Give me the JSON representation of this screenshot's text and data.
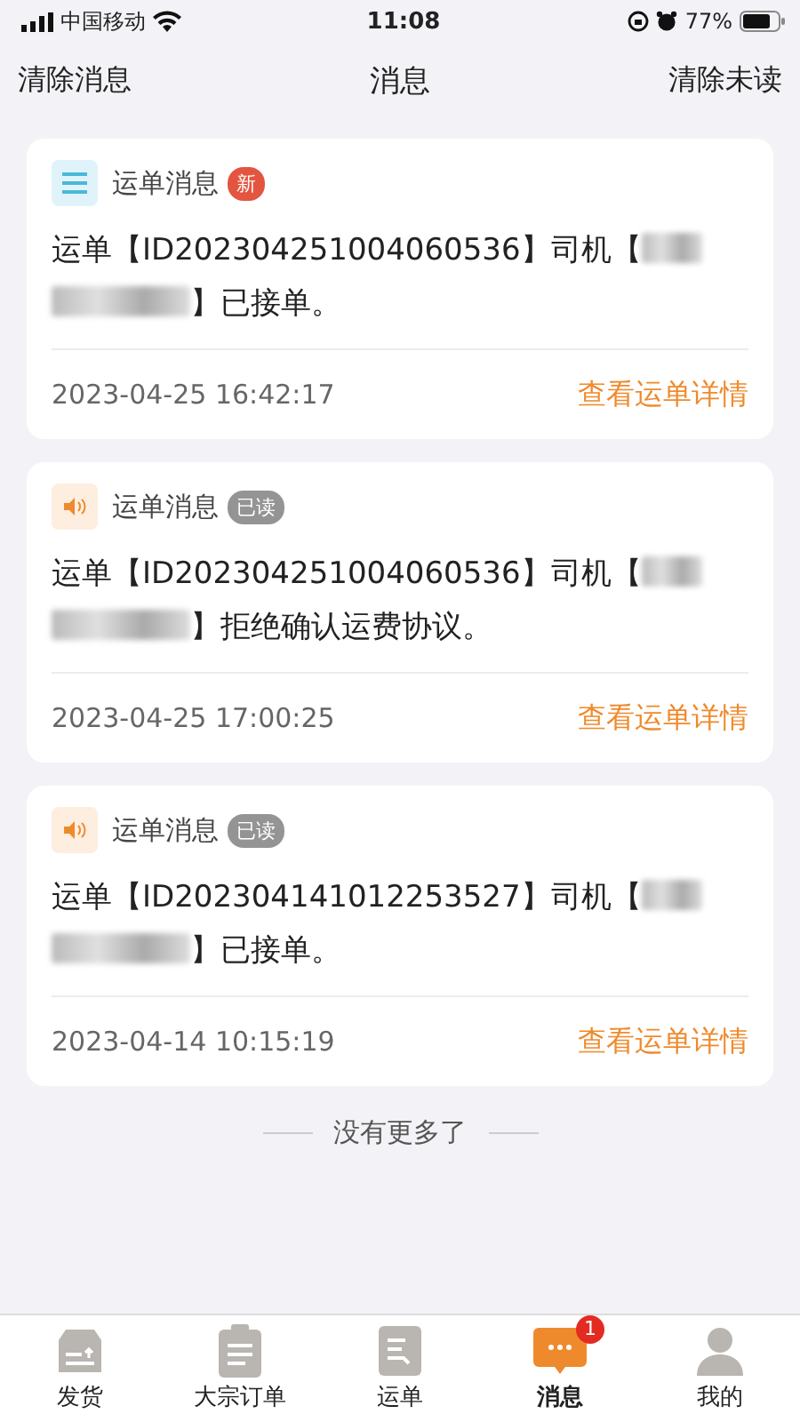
{
  "status_bar": {
    "carrier": "中国移动",
    "time": "11:08",
    "battery": "77%"
  },
  "nav": {
    "left": "清除消息",
    "title": "消息",
    "right": "清除未读"
  },
  "messages": [
    {
      "kind": "list",
      "category": "运单消息",
      "tag": {
        "text": "新",
        "kind": "new"
      },
      "text_before": "运单【ID202304251004060536】司机【",
      "text_after": "】已接单。",
      "time": "2023-04-25 16:42:17",
      "link": "查看运单详情"
    },
    {
      "kind": "speaker",
      "category": "运单消息",
      "tag": {
        "text": "已读",
        "kind": "read"
      },
      "text_before": "运单【ID202304251004060536】司机【",
      "text_after": "】拒绝确认运费协议。",
      "time": "2023-04-25 17:00:25",
      "link": "查看运单详情"
    },
    {
      "kind": "speaker",
      "category": "运单消息",
      "tag": {
        "text": "已读",
        "kind": "read"
      },
      "text_before": "运单【ID202304141012253527】司机【",
      "text_after": "】已接单。",
      "time": "2023-04-14 10:15:19",
      "link": "查看运单详情"
    }
  ],
  "end_note": "没有更多了",
  "tabs": [
    {
      "label": "发货",
      "selected": false
    },
    {
      "label": "大宗订单",
      "selected": false
    },
    {
      "label": "运单",
      "selected": false
    },
    {
      "label": "消息",
      "selected": true,
      "badge": "1"
    },
    {
      "label": "我的",
      "selected": false
    }
  ]
}
